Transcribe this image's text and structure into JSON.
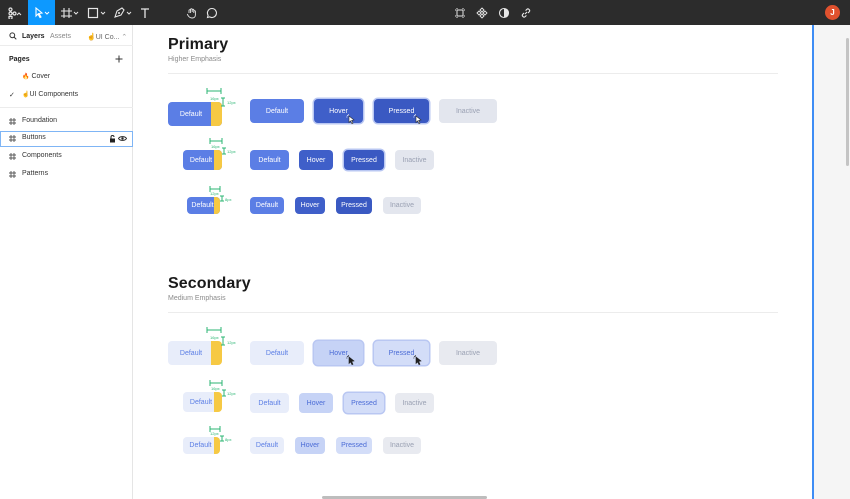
{
  "toolbar": {
    "avatar_initial": "J"
  },
  "sidebar": {
    "tab_layers": "Layers",
    "tab_assets": "Assets",
    "file_name": "UI Co...",
    "pages_title": "Pages",
    "pages": [
      {
        "label": "Cover",
        "prefix": "🔥"
      },
      {
        "label": "UI Components",
        "prefix": "☝️"
      }
    ],
    "layers": [
      "Foundation",
      "Buttons",
      "Components",
      "Patterns"
    ]
  },
  "canvas": {
    "primary": {
      "title": "Primary",
      "subtitle": "Higher Emphasis"
    },
    "secondary": {
      "title": "Secondary",
      "subtitle": "Medium Emphasis"
    },
    "labels": {
      "default": "Default",
      "hover": "Hover",
      "pressed": "Pressed",
      "inactive": "Inactive"
    },
    "measure": {
      "w1": "16px",
      "h1": "12px",
      "w2": "16px",
      "h2": "12px",
      "w3": "12px",
      "h3": "8px"
    }
  },
  "colors": {
    "accent": "#0d99ff",
    "primary": "#5b7ee5",
    "measure": "#2bb673",
    "highlight": "#f6c944"
  }
}
